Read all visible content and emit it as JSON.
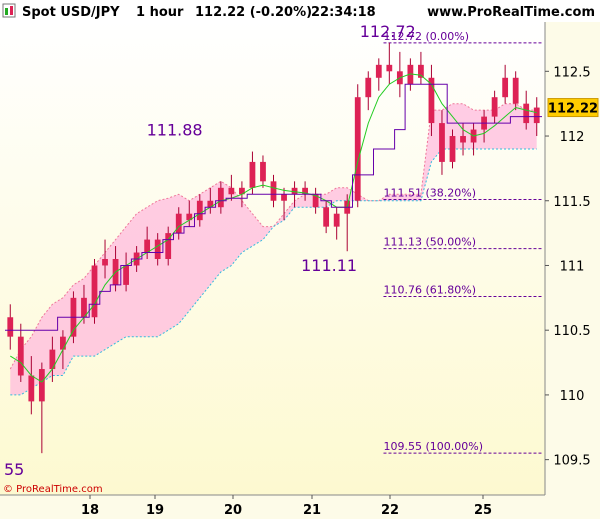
{
  "header": {
    "instrument": "Spot USD/JPY",
    "timeframe": "1 hour",
    "price_change": "112.22 (-0.20%)",
    "time": "22:34:18",
    "site": "www.ProRealTime.com"
  },
  "footer": {
    "copyright": "© ProRealTime.com"
  },
  "current_price": {
    "value": 112.22,
    "label": "112.22"
  },
  "colors": {
    "up": "#dd2255",
    "down": "#dd2255",
    "wick": "#aa0033",
    "ma_green": "#22cc22",
    "ma_purple": "#6600aa",
    "cloud_pink": "#ffbbdd",
    "cloud_green": "#aaeeaa",
    "fib": "#660099",
    "price_tag": "#ffcc00",
    "bg_top": "#ffffff",
    "bg_bottom": "#fdf9d0"
  },
  "chart_data": {
    "type": "candlestick",
    "y_axis": {
      "min": 109.25,
      "max": 112.85,
      "ticks": [
        "112.5",
        "112",
        "111.5",
        "111",
        "110.5",
        "110",
        "109.5"
      ],
      "position": "right"
    },
    "x_axis": {
      "ticks": [
        "18",
        "19",
        "20",
        "21",
        "22",
        "25"
      ]
    },
    "annotations": [
      {
        "text": "112.72",
        "value": 112.72
      },
      {
        "text": "111.88",
        "value": 111.88
      },
      {
        "text": "111.11",
        "value": 111.11
      },
      {
        "text": "55",
        "value": 109.55
      }
    ],
    "fibonacci": [
      {
        "value": 112.72,
        "label": "112.72 (0.00%)"
      },
      {
        "value": 111.51,
        "label": "111.51 (38.20%)"
      },
      {
        "value": 111.13,
        "label": "111.13 (50.00%)"
      },
      {
        "value": 110.76,
        "label": "110.76 (61.80%)"
      },
      {
        "value": 109.55,
        "label": "109.55 (100.00%)"
      }
    ],
    "candles": [
      [
        110.6,
        110.7,
        110.35,
        110.45
      ],
      [
        110.45,
        110.55,
        110.1,
        110.15
      ],
      [
        110.15,
        110.3,
        109.85,
        109.95
      ],
      [
        109.95,
        110.25,
        109.55,
        110.2
      ],
      [
        110.2,
        110.45,
        110.1,
        110.35
      ],
      [
        110.35,
        110.5,
        110.2,
        110.45
      ],
      [
        110.45,
        110.8,
        110.4,
        110.75
      ],
      [
        110.75,
        110.85,
        110.55,
        110.6
      ],
      [
        110.6,
        111.05,
        110.55,
        111.0
      ],
      [
        111.0,
        111.2,
        110.9,
        111.05
      ],
      [
        111.05,
        111.15,
        110.8,
        110.85
      ],
      [
        110.85,
        111.1,
        110.8,
        111.0
      ],
      [
        111.0,
        111.15,
        110.95,
        111.1
      ],
      [
        111.1,
        111.3,
        111.05,
        111.2
      ],
      [
        111.2,
        111.25,
        111.0,
        111.05
      ],
      [
        111.05,
        111.3,
        111.0,
        111.25
      ],
      [
        111.25,
        111.45,
        111.2,
        111.4
      ],
      [
        111.4,
        111.5,
        111.3,
        111.35
      ],
      [
        111.35,
        111.55,
        111.3,
        111.5
      ],
      [
        111.5,
        111.6,
        111.4,
        111.45
      ],
      [
        111.45,
        111.65,
        111.4,
        111.6
      ],
      [
        111.6,
        111.7,
        111.5,
        111.55
      ],
      [
        111.55,
        111.65,
        111.45,
        111.6
      ],
      [
        111.6,
        111.88,
        111.55,
        111.8
      ],
      [
        111.8,
        111.85,
        111.6,
        111.65
      ],
      [
        111.65,
        111.7,
        111.45,
        111.5
      ],
      [
        111.5,
        111.6,
        111.35,
        111.55
      ],
      [
        111.55,
        111.65,
        111.45,
        111.6
      ],
      [
        111.6,
        111.65,
        111.5,
        111.55
      ],
      [
        111.55,
        111.6,
        111.4,
        111.45
      ],
      [
        111.45,
        111.5,
        111.25,
        111.3
      ],
      [
        111.3,
        111.45,
        111.2,
        111.4
      ],
      [
        111.4,
        111.55,
        111.11,
        111.5
      ],
      [
        111.5,
        112.4,
        111.45,
        112.3
      ],
      [
        112.3,
        112.5,
        112.2,
        112.45
      ],
      [
        112.45,
        112.6,
        112.35,
        112.55
      ],
      [
        112.55,
        112.72,
        112.4,
        112.5
      ],
      [
        112.5,
        112.65,
        112.3,
        112.4
      ],
      [
        112.4,
        112.6,
        112.35,
        112.55
      ],
      [
        112.55,
        112.65,
        112.4,
        112.45
      ],
      [
        112.45,
        112.55,
        112.0,
        112.1
      ],
      [
        112.1,
        112.2,
        111.7,
        111.8
      ],
      [
        111.8,
        112.05,
        111.75,
        112.0
      ],
      [
        112.0,
        112.1,
        111.85,
        111.95
      ],
      [
        111.95,
        112.1,
        111.85,
        112.05
      ],
      [
        112.05,
        112.2,
        111.95,
        112.15
      ],
      [
        112.15,
        112.35,
        112.1,
        112.3
      ],
      [
        112.3,
        112.55,
        112.25,
        112.45
      ],
      [
        112.45,
        112.5,
        112.2,
        112.25
      ],
      [
        112.25,
        112.35,
        112.05,
        112.1
      ],
      [
        112.1,
        112.3,
        112.0,
        112.22
      ]
    ],
    "ma_green": [
      110.3,
      110.25,
      110.15,
      110.1,
      110.2,
      110.35,
      110.5,
      110.6,
      110.7,
      110.85,
      110.95,
      111.0,
      111.05,
      111.1,
      111.15,
      111.2,
      111.3,
      111.35,
      111.4,
      111.45,
      111.5,
      111.52,
      111.55,
      111.6,
      111.62,
      111.6,
      111.58,
      111.57,
      111.56,
      111.54,
      111.5,
      111.45,
      111.45,
      111.8,
      112.1,
      112.3,
      112.4,
      112.45,
      112.48,
      112.47,
      112.4,
      112.25,
      112.15,
      112.05,
      112.0,
      112.02,
      112.08,
      112.15,
      112.22,
      112.2,
      112.18
    ],
    "ma_purple": [
      110.5,
      110.5,
      110.5,
      110.5,
      110.5,
      110.6,
      110.6,
      110.6,
      110.7,
      110.8,
      110.85,
      111.0,
      111.05,
      111.1,
      111.1,
      111.2,
      111.25,
      111.3,
      111.4,
      111.45,
      111.5,
      111.52,
      111.52,
      111.55,
      111.55,
      111.55,
      111.55,
      111.55,
      111.55,
      111.55,
      111.5,
      111.45,
      111.45,
      111.7,
      111.7,
      111.9,
      111.9,
      112.05,
      112.4,
      112.4,
      112.4,
      112.4,
      112.1,
      112.1,
      112.1,
      112.1,
      112.1,
      112.1,
      112.15,
      112.15,
      112.15
    ],
    "cloud_top": [
      110.2,
      110.35,
      110.45,
      110.6,
      110.7,
      110.75,
      110.85,
      110.9,
      111.0,
      111.1,
      111.2,
      111.3,
      111.4,
      111.45,
      111.5,
      111.52,
      111.55,
      111.5,
      111.55,
      111.6,
      111.65,
      111.6,
      111.5,
      111.4,
      111.3,
      111.3,
      111.4,
      111.5,
      111.55,
      111.55,
      111.55,
      111.6,
      111.6,
      111.55,
      111.5,
      111.5,
      111.55,
      111.55,
      111.55,
      111.55,
      112.2,
      112.2,
      112.25,
      112.25,
      112.2,
      112.2,
      112.2,
      112.25,
      112.25,
      112.2,
      112.2
    ],
    "cloud_bottom": [
      110.0,
      110.0,
      110.05,
      110.1,
      110.15,
      110.15,
      110.3,
      110.3,
      110.3,
      110.35,
      110.4,
      110.45,
      110.45,
      110.45,
      110.45,
      110.5,
      110.55,
      110.65,
      110.75,
      110.85,
      110.95,
      111.0,
      111.1,
      111.15,
      111.2,
      111.3,
      111.35,
      111.45,
      111.45,
      111.45,
      111.45,
      111.5,
      111.5,
      111.5,
      111.5,
      111.5,
      111.5,
      111.5,
      111.5,
      111.5,
      111.8,
      111.9,
      111.9,
      111.9,
      111.9,
      111.9,
      111.9,
      111.9,
      111.9,
      111.9,
      111.9
    ]
  }
}
